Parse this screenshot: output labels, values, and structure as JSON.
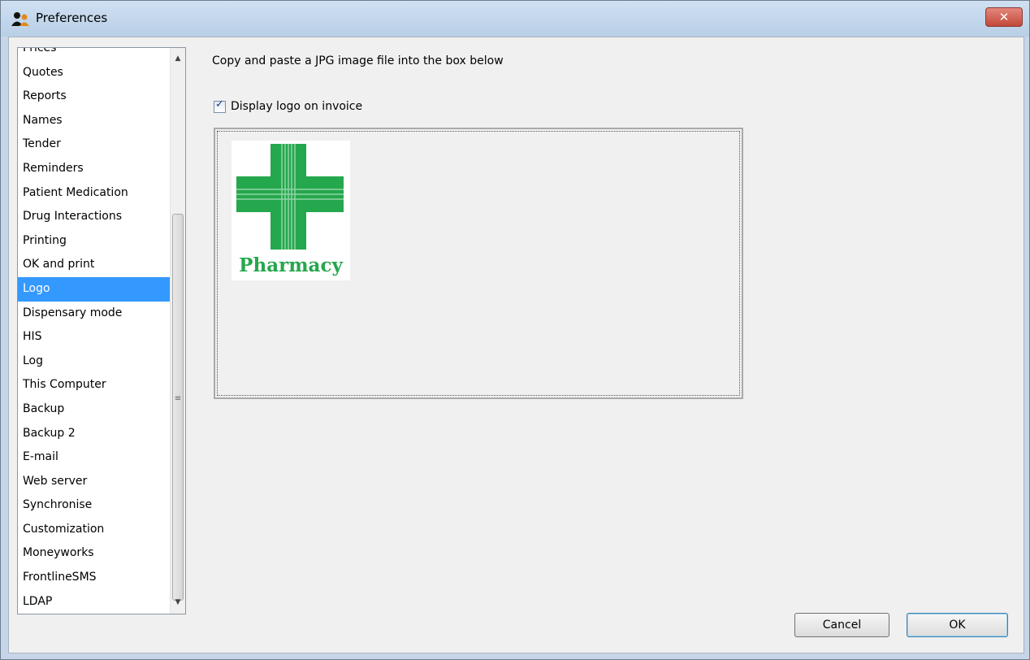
{
  "window": {
    "title": "Preferences",
    "app_icon": "user-group-icon",
    "close_icon": "close-icon"
  },
  "sidebar": {
    "selected_index": 9,
    "items": [
      "Prices",
      "Quotes",
      "Reports",
      "Names",
      "Tender",
      "Reminders",
      "Patient Medication",
      "Drug Interactions",
      "Printing",
      "OK and print",
      "Logo",
      "Dispensary mode",
      "HIS",
      "Log",
      "This Computer",
      "Backup",
      "Backup 2",
      "E-mail",
      "Web server",
      "Synchronise",
      "Customization",
      "Moneyworks",
      "FrontlineSMS",
      "LDAP"
    ]
  },
  "main": {
    "instruction": "Copy and paste a JPG image file into the box below",
    "display_logo_label": "Display logo on invoice",
    "display_logo_checked": true,
    "logo": {
      "text": "Pharmacy",
      "color": "#25a74d"
    }
  },
  "buttons": {
    "cancel": "Cancel",
    "ok": "OK"
  },
  "colors": {
    "selection": "#3399ff",
    "window_frame": "#c6d6e8"
  }
}
